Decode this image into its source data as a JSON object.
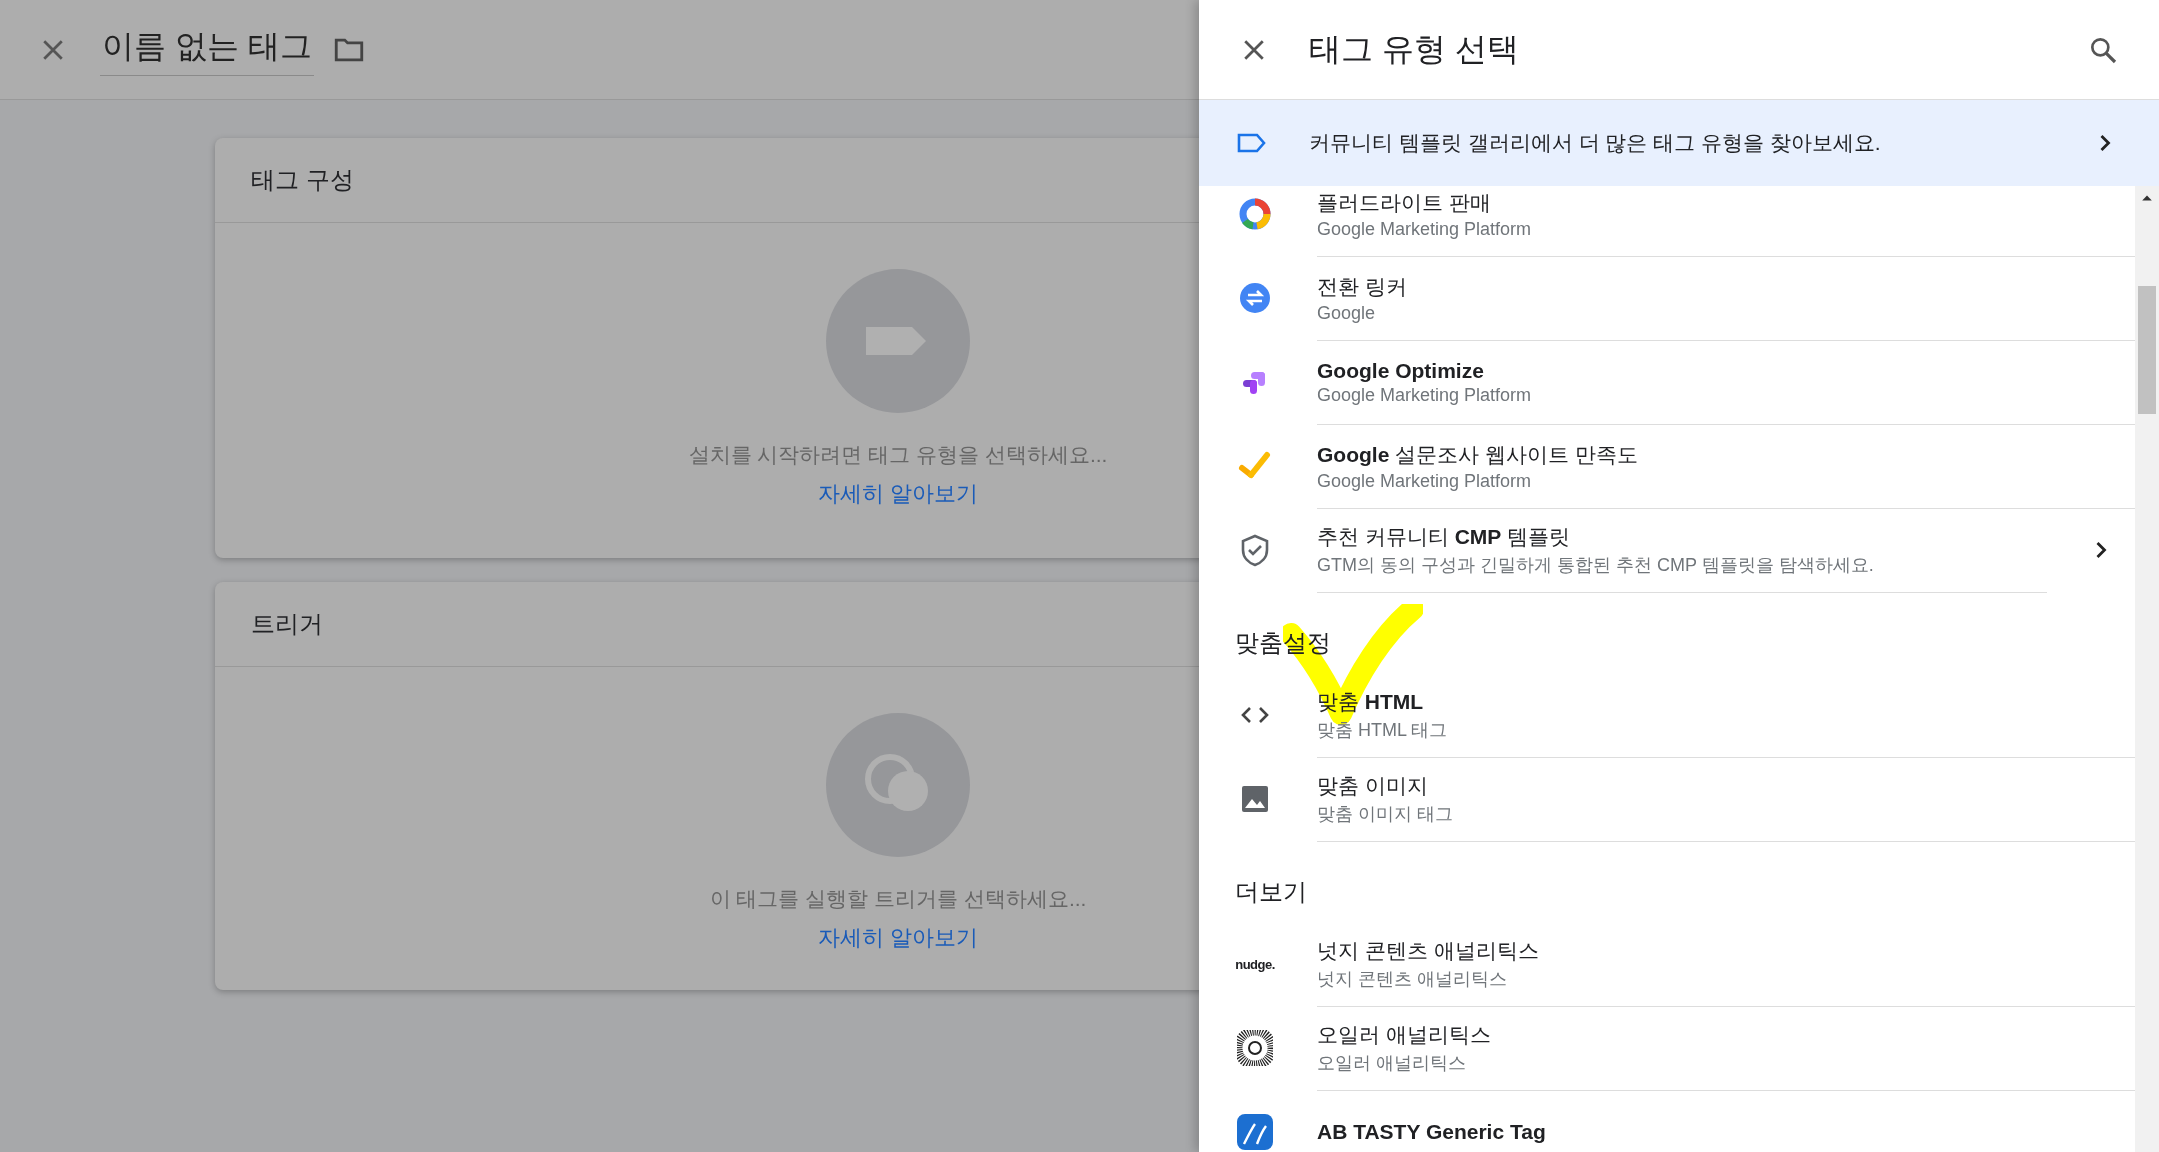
{
  "editor": {
    "title": "이름 없는 태그",
    "cards": [
      {
        "kind": "tag",
        "title": "태그 구성",
        "hint": "설치를 시작하려면 태그 유형을 선택하세요...",
        "link": "자세히 알아보기"
      },
      {
        "kind": "trigger",
        "title": "트리거",
        "hint": "이 태그를 실행할 트리거를 선택하세요...",
        "link": "자세히 알아보기"
      }
    ]
  },
  "panel": {
    "title": "태그 유형 선택",
    "banner": "커뮤니티 템플릿 갤러리에서 더 많은 태그 유형을 찾아보세요.",
    "sections": [
      {
        "items": [
          {
            "kind": "ring",
            "title": "플러드라이트 판매",
            "subtitle": "Google Marketing Platform"
          },
          {
            "kind": "swap",
            "title": "전환 링커",
            "subtitle": "Google"
          },
          {
            "kind": "optimize",
            "title": "Google Optimize",
            "bold": true,
            "subtitle": "Google Marketing Platform"
          },
          {
            "kind": "survey",
            "title": "**Google** 설문조사 웹사이트 만족도",
            "subtitle": "Google Marketing Platform"
          },
          {
            "kind": "shield",
            "title": "추천 커뮤니티 **CMP** 템플릿",
            "subtitle": "GTM의 동의 구성과 긴밀하게 통합된 추천 CMP 템플릿을 탐색하세요.",
            "chevron": true
          }
        ]
      },
      {
        "heading": "맞춤설정",
        "items": [
          {
            "kind": "code",
            "title": "맞춤 **HTML**",
            "subtitle": "맞춤 HTML 태그"
          },
          {
            "kind": "image",
            "title": "맞춤 이미지",
            "subtitle": "맞춤 이미지 태그"
          }
        ]
      },
      {
        "heading": "더보기",
        "items": [
          {
            "kind": "nudge",
            "logo_text": "nudge.",
            "title": "넛지 콘텐츠 애널리틱스",
            "subtitle": "넛지 콘텐츠 애널리틱스"
          },
          {
            "kind": "sun",
            "title": "오일러 애널리틱스",
            "subtitle": "오일러 애널리틱스"
          },
          {
            "kind": "abtasty",
            "title": "AB TASTY Generic Tag",
            "bold": true
          }
        ]
      }
    ]
  },
  "annotation": {
    "kind": "checkmark"
  }
}
